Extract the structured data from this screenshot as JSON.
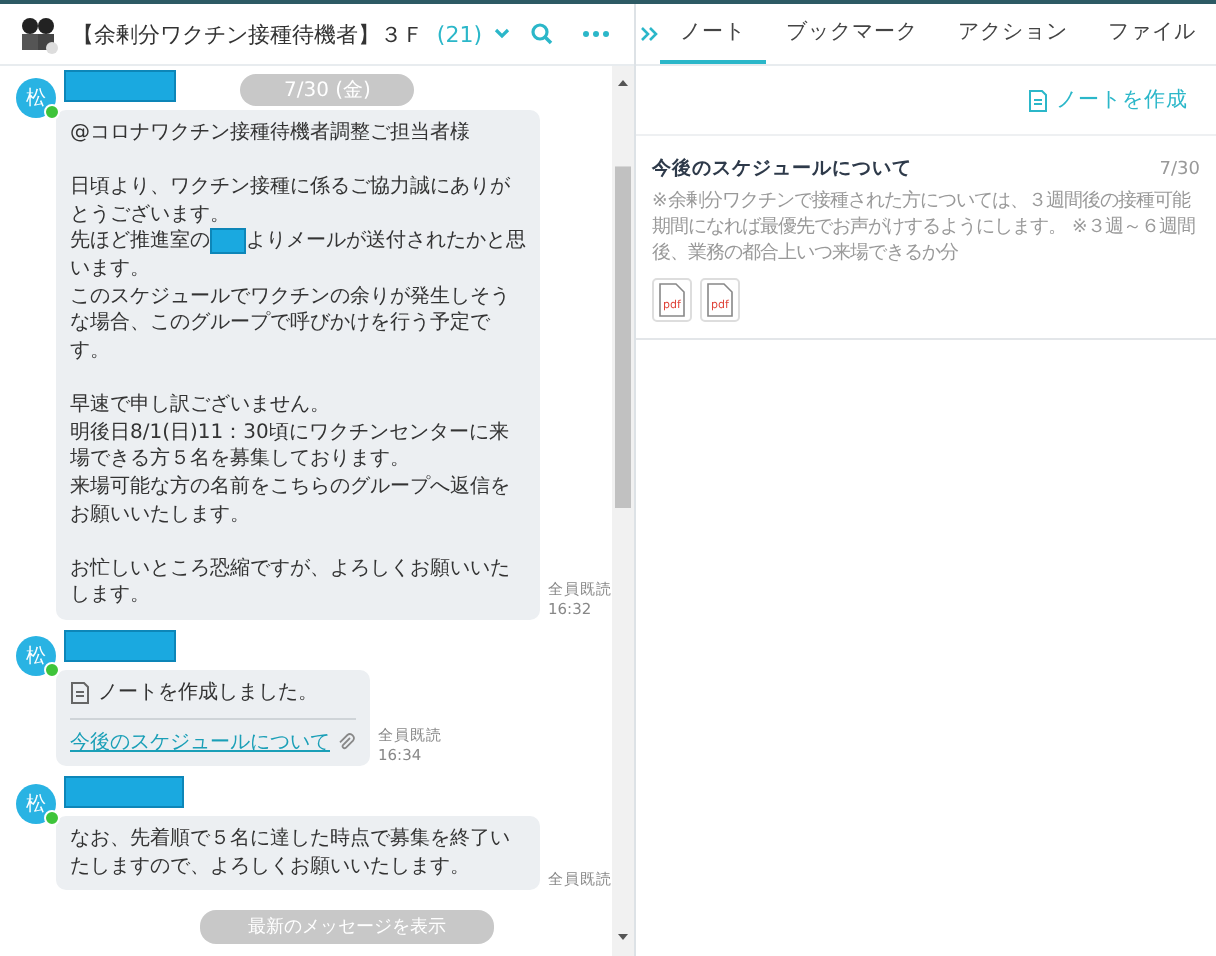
{
  "header": {
    "title": "【余剰分ワクチン接種待機者】３Ｆ",
    "member_count": "(21)"
  },
  "date_separator": "7/30 (金)",
  "messages": [
    {
      "kind": "text",
      "avatar": "松",
      "online": true,
      "paragraphs": [
        [
          {
            "kind": "plain",
            "text": "@コロナワクチン接種待機者調整ご担当者様"
          }
        ],
        [
          {
            "kind": "plain",
            "text": "日頃より、ワクチン接種に係るご協力誠にありがとうございます。"
          },
          {
            "kind": "redacted",
            "before": "先ほど推進室の",
            "after": "よりメールが送付されたかと思います。"
          },
          {
            "kind": "plain",
            "text": "このスケジュールでワクチンの余りが発生しそうな場合、このグループで呼びかけを行う予定です。"
          }
        ],
        [
          {
            "kind": "plain",
            "text": "早速で申し訳ございません。"
          },
          {
            "kind": "plain",
            "text": "明後日8/1(日)11：30頃にワクチンセンターに来場できる方５名を募集しております。"
          },
          {
            "kind": "plain",
            "text": "来場可能な方の名前をこちらのグループへ返信をお願いいたします。"
          }
        ],
        [
          {
            "kind": "plain",
            "text": "お忙しいところ恐縮ですが、よろしくお願いいたします。"
          }
        ]
      ],
      "read_status": "全員既読",
      "time": "16:32"
    },
    {
      "kind": "note",
      "avatar": "松",
      "online": true,
      "note_text": "ノートを作成しました。",
      "link": "今後のスケジュールについて",
      "read_status": "全員既読",
      "time": "16:34"
    },
    {
      "kind": "text",
      "avatar": "松",
      "online": true,
      "paragraphs": [
        [
          {
            "kind": "plain",
            "text": "なお、先着順で５名に達した時点で募集を終了いたしますので、よろしくお願いいたします。"
          }
        ]
      ],
      "read_status": "全員既読"
    }
  ],
  "new_messages_button": "最新のメッセージを表示",
  "side_panel": {
    "tabs": [
      {
        "label": "ノート",
        "selected": true
      },
      {
        "label": "ブックマーク",
        "selected": false
      },
      {
        "label": "アクション",
        "selected": false
      },
      {
        "label": "ファイル",
        "selected": false
      }
    ],
    "create_note": "ノートを作成",
    "notes": [
      {
        "title": "今後のスケジュールについて",
        "date": "7/30",
        "preview": "※余剰分ワクチンで接種された方については、３週間後の接種可能期間になれば最優先でお声がけするようにします。 ※３週～６週間後、業務の都合上いつ来場できるか分",
        "attachments": [
          "pdf",
          "pdf"
        ]
      }
    ]
  }
}
